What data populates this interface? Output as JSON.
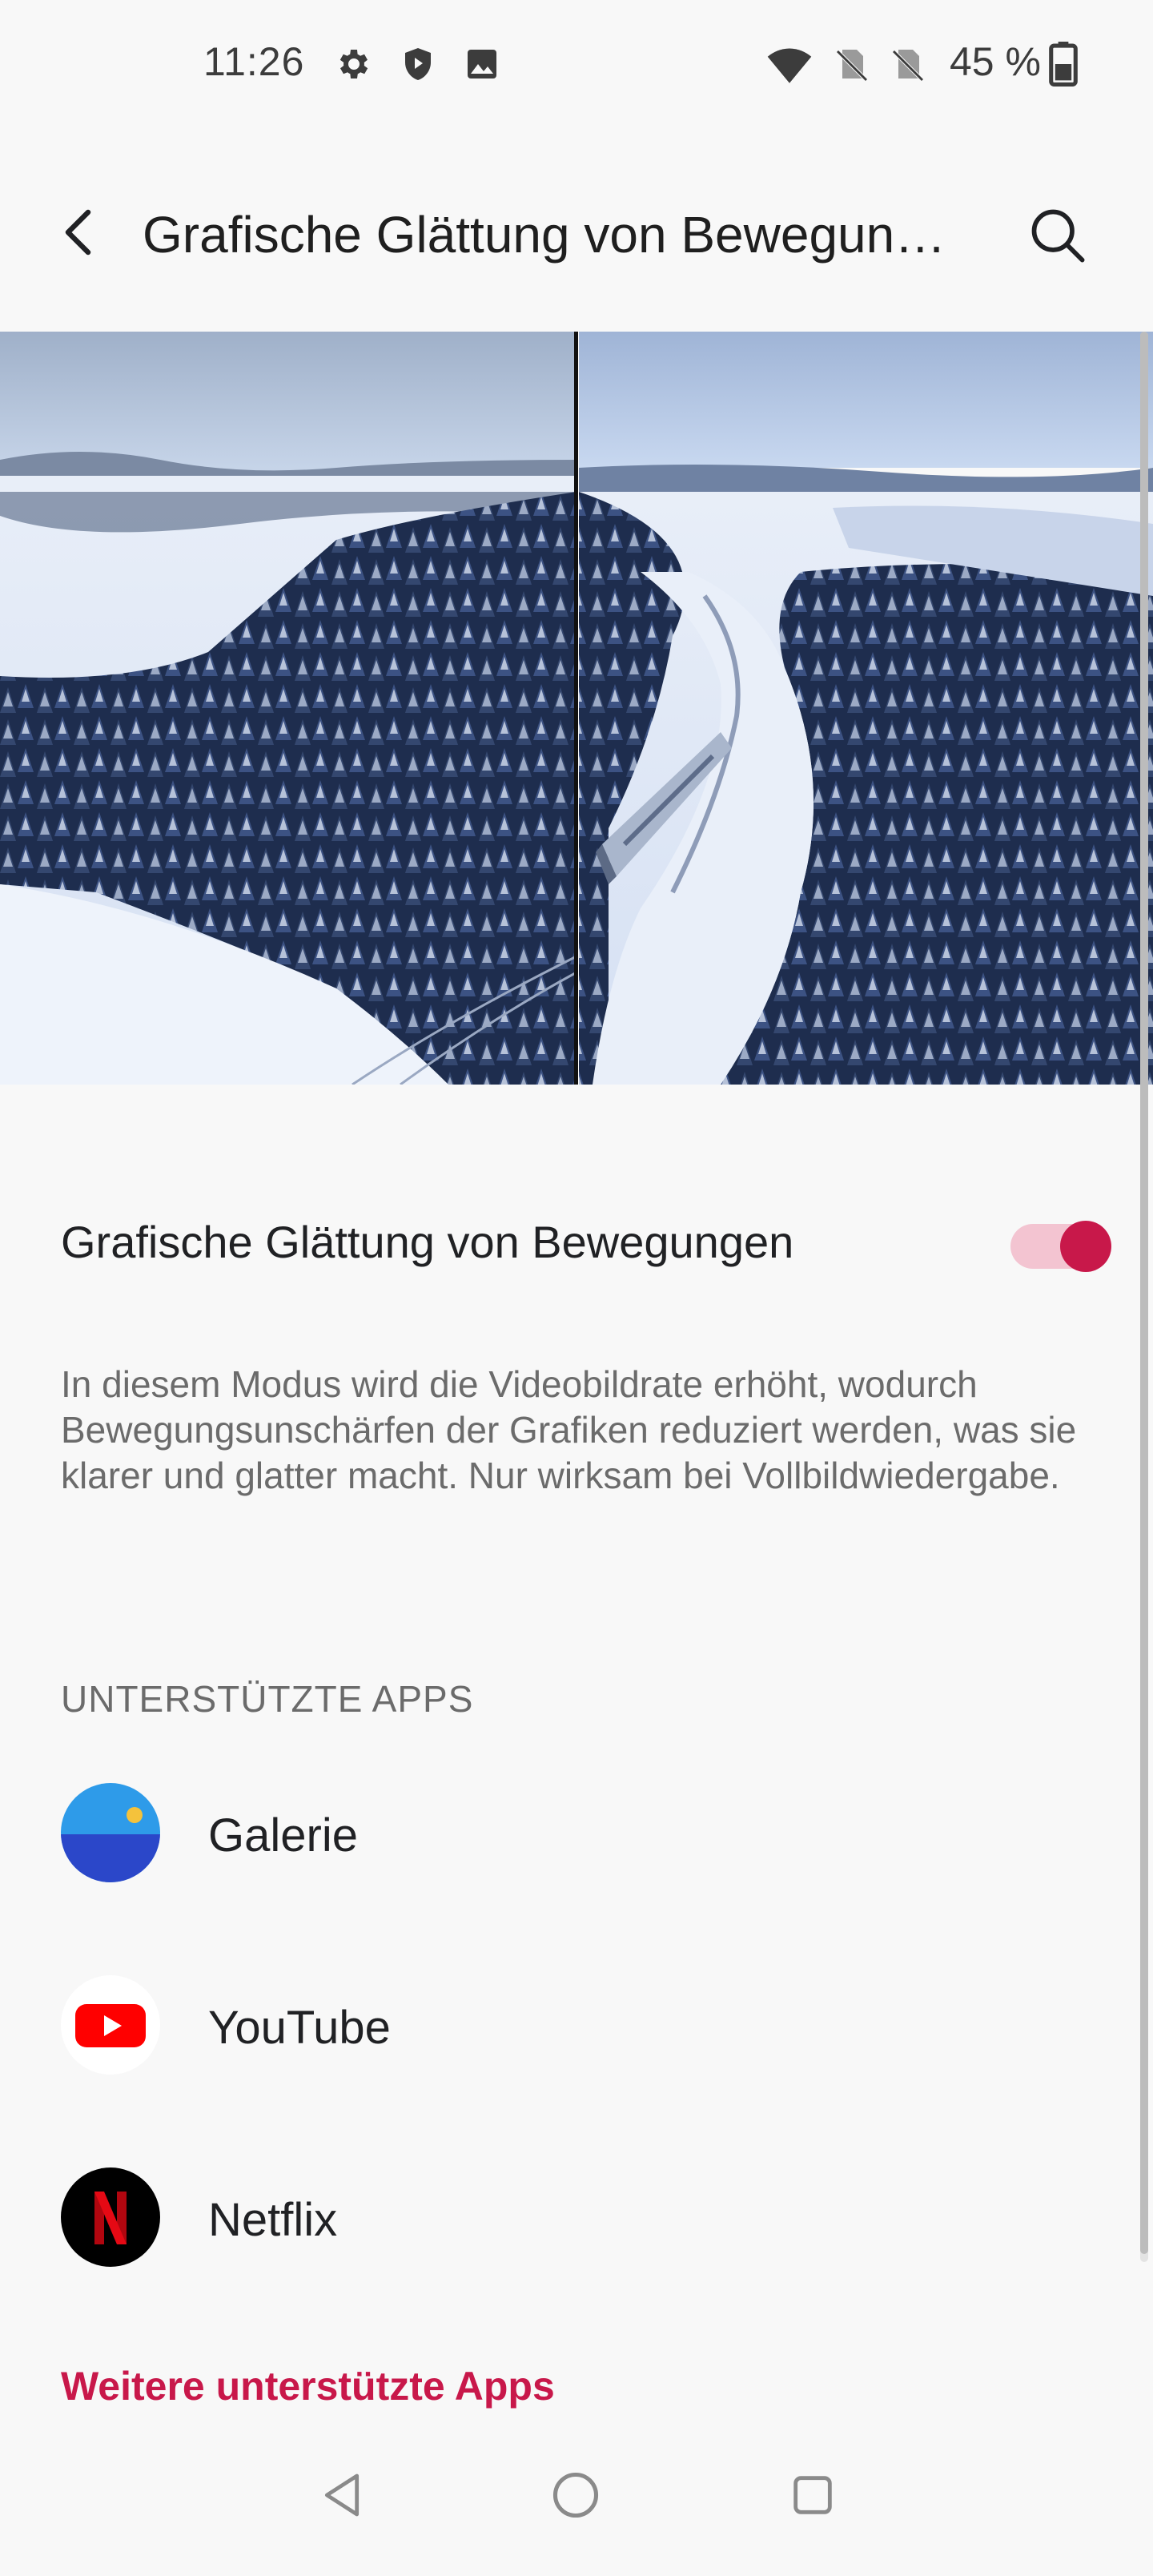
{
  "status_bar": {
    "time": "11:26",
    "battery_percent": "45 %",
    "left_icons": [
      "gear-icon",
      "shield-icon",
      "image-icon"
    ],
    "right_icons": [
      "wifi-icon",
      "no-sim-icon",
      "no-sim-icon",
      "battery-icon"
    ]
  },
  "app_bar": {
    "title": "Grafische Glättung von Bewegun…"
  },
  "toggle": {
    "label": "Grafische Glättung von Bewegungen",
    "state": "on",
    "accent_color": "#c8184a"
  },
  "description": "In diesem Modus wird die Videobildrate erhöht, wodurch Bewegungsunschärfen der Grafiken reduziert werden, was sie klarer und glatter macht. Nur wirksam bei Vollbildwiedergabe.",
  "supported_apps": {
    "header": "UNTERSTÜTZTE APPS",
    "items": [
      {
        "name": "Galerie",
        "icon": "gallery-icon"
      },
      {
        "name": "YouTube",
        "icon": "youtube-icon"
      },
      {
        "name": "Netflix",
        "icon": "netflix-icon"
      }
    ],
    "more_link": "Weitere unterstützte Apps"
  },
  "nav_bar": {
    "buttons": [
      "back-triangle-icon",
      "home-circle-icon",
      "recents-square-icon"
    ]
  }
}
